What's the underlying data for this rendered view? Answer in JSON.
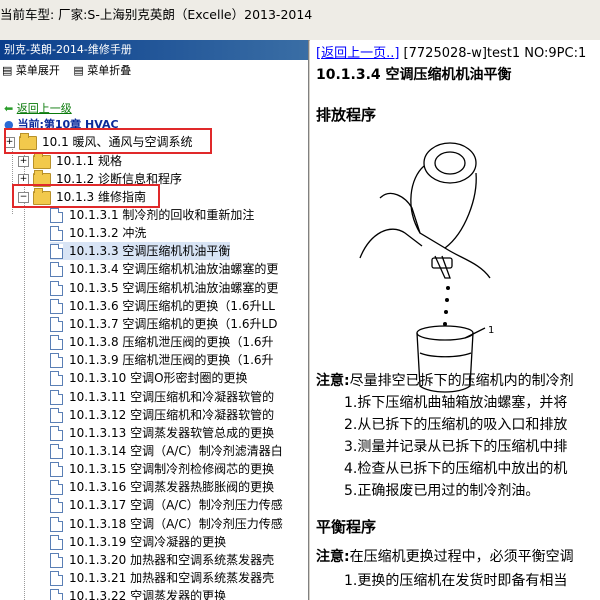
{
  "topbar": {
    "text": "当前车型:   厂家:S-上海别克英朗（Excelle）2013-2014"
  },
  "left_panel": {
    "title": "别克-英朗-2014-维修手册",
    "toolbar": [
      "菜单展开",
      "菜单折叠"
    ],
    "back_link": "返回上一级",
    "current_chapter": "当前:第10章 HVAC",
    "tree": [
      {
        "label": "10.1 暖风、通风与空调系统",
        "expander": "+"
      },
      {
        "label": "10.1.1 规格",
        "expander": "+"
      },
      {
        "label": "10.1.2 诊断信息和程序",
        "expander": "+"
      },
      {
        "label": "10.1.3 维修指南",
        "expander": "−"
      }
    ],
    "docs": [
      "10.1.3.1 制冷剂的回收和重新加注",
      "10.1.3.2 冲洗",
      "10.1.3.3 空调压缩机机油平衡",
      "10.1.3.4 空调压缩机机油放油螺塞的更",
      "10.1.3.5 空调压缩机机油放油螺塞的更",
      "10.1.3.6 空调压缩机的更换（1.6升LL",
      "10.1.3.7 空调压缩机的更换（1.6升LD",
      "10.1.3.8 压缩机泄压阀的更换（1.6升",
      "10.1.3.9 压缩机泄压阀的更换（1.6升",
      "10.1.3.10 空调O形密封圈的更换",
      "10.1.3.11 空调压缩机和冷凝器软管的",
      "10.1.3.12 空调压缩机和冷凝器软管的",
      "10.1.3.13 空调蒸发器软管总成的更换",
      "10.1.3.14 空调（A/C）制冷剂滤清器白",
      "10.1.3.15 空调制冷剂检修阀芯的更换",
      "10.1.3.16 空调蒸发器热膨胀阀的更换",
      "10.1.3.17 空调（A/C）制冷剂压力传感",
      "10.1.3.18 空调（A/C）制冷剂压力传感",
      "10.1.3.19 空调冷凝器的更换",
      "10.1.3.20 加热器和空调系统蒸发器壳",
      "10.1.3.21 加热器和空调系统蒸发器壳",
      "10.1.3.22 空调蒸发器的更换"
    ],
    "selected_index": 2
  },
  "right_panel": {
    "back_link": "[返回上一页..]",
    "doc_id": " [7725028-w]test1 NO:9PC:1",
    "heading": "10.1.3.4 空调压缩机机油平衡",
    "section1": "排放程序",
    "callout": "1",
    "note1_label": "注意:",
    "note1_text": "尽量排空已拆下的压缩机内的制冷剂",
    "steps": [
      "1.拆下压缩机曲轴箱放油螺塞，并将",
      "2.从已拆下的压缩机的吸入口和排放",
      "3.测量并记录从已拆下的压缩机中排",
      "4.检查从已拆下的压缩机中放出的机",
      "5.正确报废已用过的制冷剂油。"
    ],
    "section2": "平衡程序",
    "note2_label": "注意:",
    "note2_text": "在压缩机更换过程中，必须平衡空调",
    "step2_1": "1.更换的压缩机在发货时即备有相当"
  }
}
